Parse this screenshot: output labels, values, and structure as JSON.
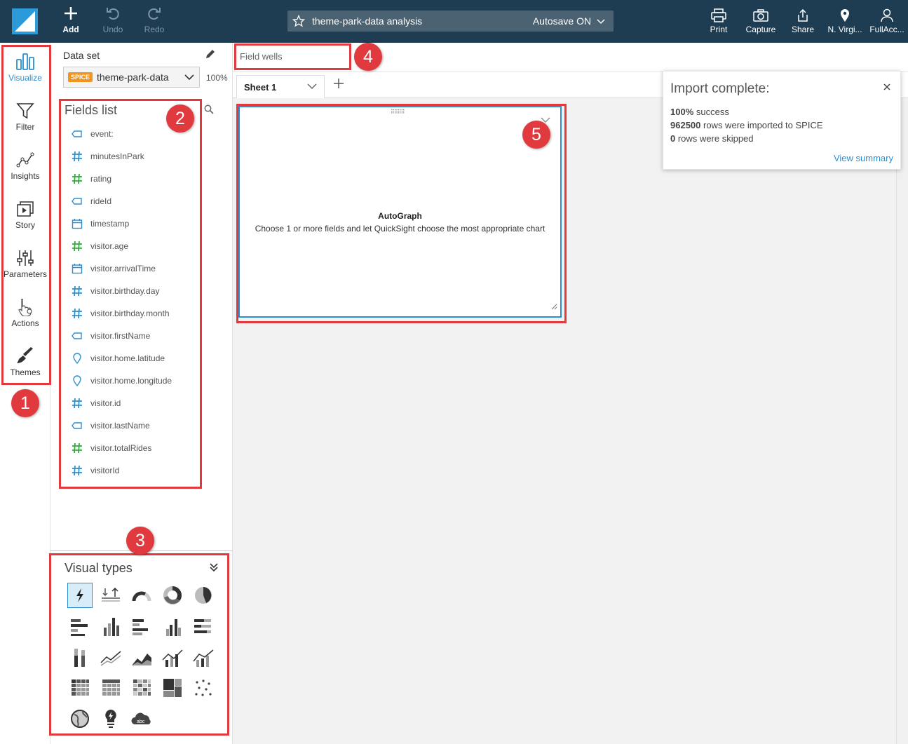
{
  "topbar": {
    "add": "Add",
    "undo": "Undo",
    "redo": "Redo",
    "analysis_title": "theme-park-data analysis",
    "autosave": "Autosave ON",
    "print": "Print",
    "capture": "Capture",
    "share": "Share",
    "region": "N. Virgi...",
    "account": "FullAcc..."
  },
  "nav": {
    "visualize": "Visualize",
    "filter": "Filter",
    "insights": "Insights",
    "story": "Story",
    "parameters": "Parameters",
    "actions": "Actions",
    "themes": "Themes"
  },
  "dataset": {
    "label": "Data set",
    "badge": "SPICE",
    "name": "theme-park-data",
    "percent": "100%"
  },
  "fields": {
    "title": "Fields list",
    "items": [
      {
        "name": "event:",
        "type": "dimension"
      },
      {
        "name": "minutesInPark",
        "type": "measure-num"
      },
      {
        "name": "rating",
        "type": "measure"
      },
      {
        "name": "rideId",
        "type": "dimension"
      },
      {
        "name": "timestamp",
        "type": "date"
      },
      {
        "name": "visitor.age",
        "type": "measure"
      },
      {
        "name": "visitor.arrivalTime",
        "type": "date"
      },
      {
        "name": "visitor.birthday.day",
        "type": "measure-num"
      },
      {
        "name": "visitor.birthday.month",
        "type": "measure-num"
      },
      {
        "name": "visitor.firstName",
        "type": "dimension"
      },
      {
        "name": "visitor.home.latitude",
        "type": "geo"
      },
      {
        "name": "visitor.home.longitude",
        "type": "geo"
      },
      {
        "name": "visitor.id",
        "type": "measure-num"
      },
      {
        "name": "visitor.lastName",
        "type": "dimension"
      },
      {
        "name": "visitor.totalRides",
        "type": "measure"
      },
      {
        "name": "visitorId",
        "type": "measure-num"
      }
    ]
  },
  "visual_types": {
    "title": "Visual types"
  },
  "field_wells": {
    "label": "Field wells"
  },
  "sheet": {
    "name": "Sheet 1"
  },
  "visual": {
    "title": "AutoGraph",
    "description": "Choose 1 or more fields and let QuickSight choose the most appropriate chart"
  },
  "toast": {
    "title": "Import complete:",
    "success_value": "100%",
    "success_text": " success",
    "rows_value": "962500",
    "rows_text": " rows were imported to SPICE",
    "skipped_value": "0",
    "skipped_text": " rows were skipped",
    "link": "View summary"
  },
  "callouts": [
    "1",
    "2",
    "3",
    "4",
    "5"
  ],
  "colors": {
    "topbar": "#1e3d52",
    "accent": "#2a8fd1",
    "measure_green": "#2eaa3c",
    "callout_red": "#e0393e",
    "spice_orange": "#f2941d"
  }
}
